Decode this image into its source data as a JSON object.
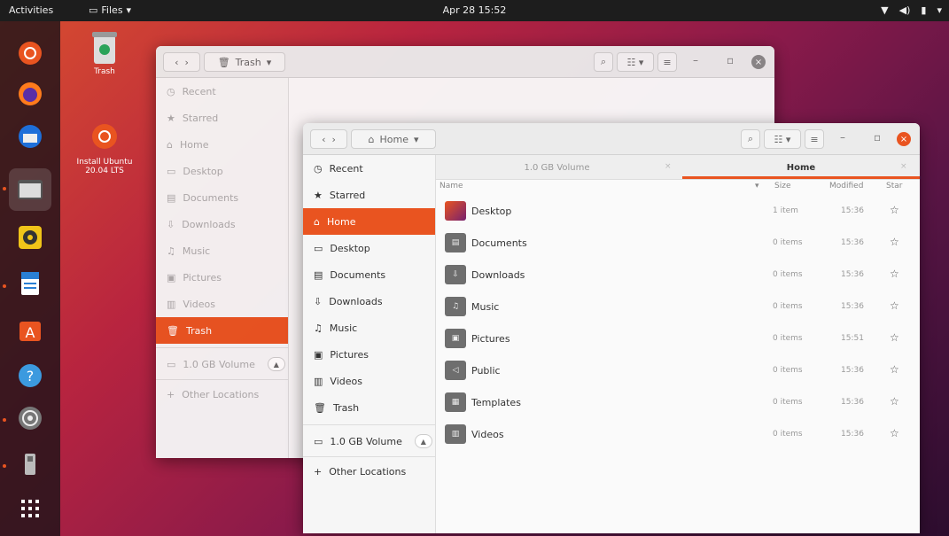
{
  "topbar": {
    "activities": "Activities",
    "app_menu": "Files",
    "clock": "Apr 28  15:52",
    "tray_icons": [
      "network-icon",
      "volume-icon",
      "battery-icon",
      "chevron-down-icon"
    ]
  },
  "dock": {
    "items": [
      {
        "name": "Ubuntu Software Updater"
      },
      {
        "name": "Firefox"
      },
      {
        "name": "Thunderbird"
      },
      {
        "name": "Files"
      },
      {
        "name": "Rhythmbox"
      },
      {
        "name": "LibreOffice Writer"
      },
      {
        "name": "Ubuntu Software"
      },
      {
        "name": "Help"
      },
      {
        "name": "Settings"
      },
      {
        "name": "USB Drive"
      },
      {
        "name": "Show Applications"
      }
    ]
  },
  "desktop": {
    "icons": [
      {
        "label": "Trash"
      },
      {
        "label": "Install Ubuntu 20.04 LTS"
      }
    ]
  },
  "back_window": {
    "path_label": "Trash",
    "sidebar": [
      {
        "label": "Recent",
        "icon": "clock-icon"
      },
      {
        "label": "Starred",
        "icon": "star-icon"
      },
      {
        "label": "Home",
        "icon": "home-icon"
      },
      {
        "label": "Desktop",
        "icon": "desktop-icon"
      },
      {
        "label": "Documents",
        "icon": "document-icon"
      },
      {
        "label": "Downloads",
        "icon": "download-icon"
      },
      {
        "label": "Music",
        "icon": "music-icon"
      },
      {
        "label": "Pictures",
        "icon": "picture-icon"
      },
      {
        "label": "Videos",
        "icon": "video-icon"
      },
      {
        "label": "Trash",
        "icon": "trash-icon"
      },
      {
        "label": "1.0 GB Volume",
        "icon": "drive-icon"
      },
      {
        "label": "Other Locations",
        "icon": "plus-icon"
      }
    ]
  },
  "front_window": {
    "path_label": "Home",
    "sidebar": [
      {
        "label": "Recent",
        "icon": "clock-icon"
      },
      {
        "label": "Starred",
        "icon": "star-icon"
      },
      {
        "label": "Home",
        "icon": "home-icon"
      },
      {
        "label": "Desktop",
        "icon": "desktop-icon"
      },
      {
        "label": "Documents",
        "icon": "document-icon"
      },
      {
        "label": "Downloads",
        "icon": "download-icon"
      },
      {
        "label": "Music",
        "icon": "music-icon"
      },
      {
        "label": "Pictures",
        "icon": "picture-icon"
      },
      {
        "label": "Videos",
        "icon": "video-icon"
      },
      {
        "label": "Trash",
        "icon": "trash-icon"
      },
      {
        "label": "1.0 GB Volume",
        "icon": "drive-icon"
      },
      {
        "label": "Other Locations",
        "icon": "plus-icon"
      }
    ],
    "tabs": [
      {
        "label": "1.0 GB Volume"
      },
      {
        "label": "Home"
      }
    ],
    "columns": {
      "name": "Name",
      "size": "Size",
      "modified": "Modified",
      "star": "Star"
    },
    "files": [
      {
        "name": "Desktop",
        "size": "1 item",
        "modified": "15:36",
        "color": "#b0306a"
      },
      {
        "name": "Documents",
        "size": "0 items",
        "modified": "15:36",
        "color": "#6e6e6e"
      },
      {
        "name": "Downloads",
        "size": "0 items",
        "modified": "15:36",
        "color": "#6e6e6e"
      },
      {
        "name": "Music",
        "size": "0 items",
        "modified": "15:36",
        "color": "#6e6e6e"
      },
      {
        "name": "Pictures",
        "size": "0 items",
        "modified": "15:51",
        "color": "#6e6e6e"
      },
      {
        "name": "Public",
        "size": "0 items",
        "modified": "15:36",
        "color": "#6e6e6e"
      },
      {
        "name": "Templates",
        "size": "0 items",
        "modified": "15:36",
        "color": "#6e6e6e"
      },
      {
        "name": "Videos",
        "size": "0 items",
        "modified": "15:36",
        "color": "#6e6e6e"
      }
    ]
  },
  "colors": {
    "accent": "#e95420",
    "dock_bg": "#2a1a22"
  }
}
